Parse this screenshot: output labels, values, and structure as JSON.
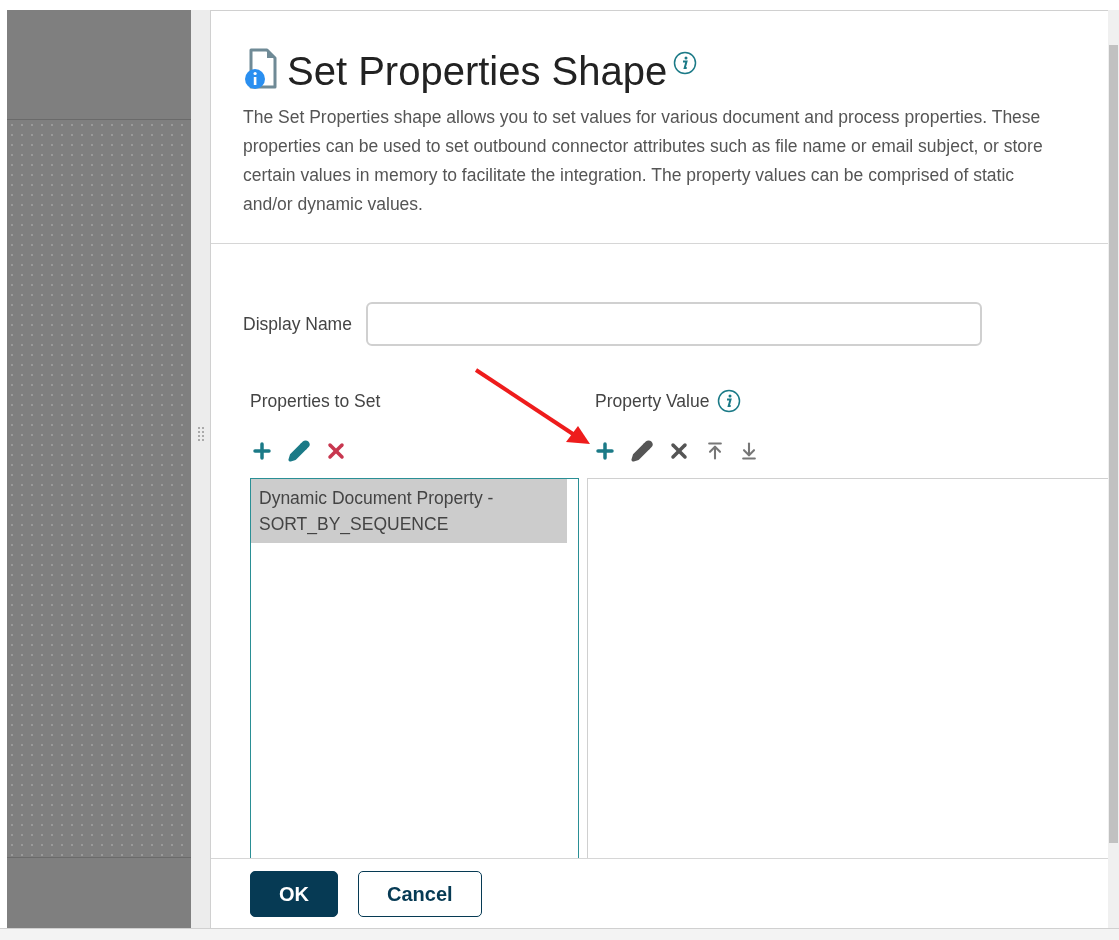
{
  "dialog": {
    "title": "Set Properties Shape",
    "description": "The Set Properties shape allows you to set values for various document and process properties. These properties can be used to set outbound connector attributes such as file name or email subject, or store certain values in memory to facilitate the integration. The property values can be comprised of static and/or dynamic values.",
    "display_name": {
      "label": "Display Name"
    },
    "properties": {
      "label": "Properties to Set",
      "items": [
        {
          "text": "Dynamic Document Property - SORT_BY_SEQUENCE",
          "selected": true
        }
      ]
    },
    "values": {
      "label": "Property Value"
    },
    "buttons": [
      {
        "label": "OK",
        "kind": "primary"
      },
      {
        "label": "Cancel",
        "kind": "secondary"
      }
    ]
  }
}
